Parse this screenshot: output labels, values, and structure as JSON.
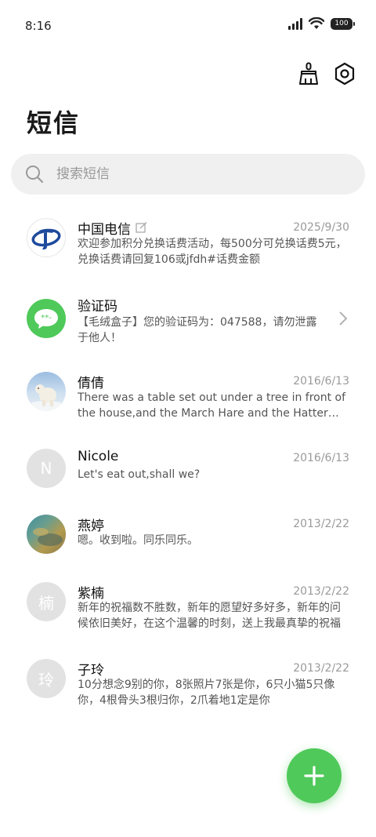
{
  "status_bar": {
    "time": "8:16",
    "battery": "100"
  },
  "header": {
    "title": "短信",
    "cleanup_icon": "broom-icon",
    "settings_icon": "gear-hexagon-icon"
  },
  "search": {
    "placeholder": "搜索短信"
  },
  "messages": [
    {
      "sender": "中国电信",
      "date": "2025/9/30",
      "preview": "欢迎参加积分兑换话费活动，每500分可兑换话费5元，兑换话费请回复106或jfdh#话费金额",
      "avatar": "china-telecom-logo",
      "has_edit_icon": true
    },
    {
      "sender": "验证码",
      "date": "",
      "preview": "【毛绒盒子】您的验证码为：047588，请勿泄露于他人！",
      "avatar": "chat-bubble-icon"
    },
    {
      "sender": "倩倩",
      "date": "2016/6/13",
      "preview": "There was a table set out under a tree in front of the house,and the March Hare and the Hatter were having tea",
      "avatar": "polar-bear-photo"
    },
    {
      "sender": "Nicole",
      "date": "2016/6/13",
      "preview": "Let's eat out,shall we?",
      "avatar_letter": "N"
    },
    {
      "sender": "燕婷",
      "date": "2013/2/22",
      "preview": "嗯。收到啦。同乐同乐。",
      "avatar": "landscape-photo"
    },
    {
      "sender": "紫楠",
      "date": "2013/2/22",
      "preview": "新年的祝福数不胜数，新年的愿望好多好多，新年的问候依旧美好，在这个温馨的时刻，送上我最真挚的祝福",
      "avatar_letter": "楠"
    },
    {
      "sender": "子玲",
      "date": "2013/2/22",
      "preview": "10分想念9别的你，8张照片7张是你，6只小猫5只像你，4根骨头3根归你，2爪着地1定是你",
      "avatar_letter": "玲"
    }
  ],
  "colors": {
    "accent": "#4fc95a",
    "telecom_blue": "#1e4a9c"
  }
}
